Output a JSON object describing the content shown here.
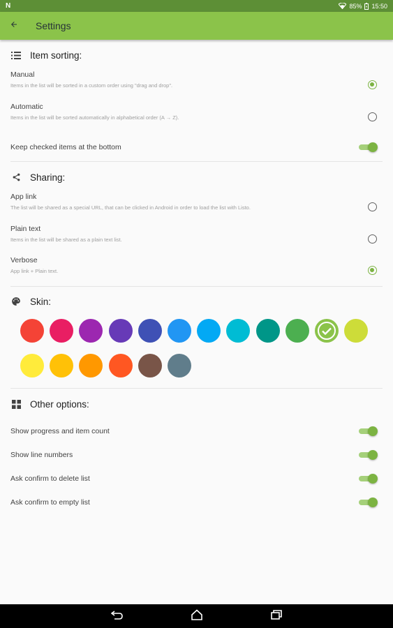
{
  "status_bar": {
    "left_icon": "N",
    "battery": "85%",
    "time": "15:50"
  },
  "app_bar": {
    "title": "Settings",
    "back_icon": "arrow-back-icon"
  },
  "sections": {
    "sorting": {
      "title": "Item sorting:",
      "icon": "list-icon",
      "manual": {
        "label": "Manual",
        "desc": "Items in the list will be sorted in a custom order using \"drag and drop\".",
        "selected": true
      },
      "automatic": {
        "label": "Automatic",
        "desc": "Items in the list will be sorted automatically in alphabetical order (A → Z).",
        "selected": false
      },
      "keep_checked": {
        "label": "Keep checked items at the bottom",
        "on": true
      }
    },
    "sharing": {
      "title": "Sharing:",
      "icon": "share-icon",
      "app_link": {
        "label": "App link",
        "desc": "The list will be shared as a special URL, that can be clicked in Android in order to load the list with Listo.",
        "selected": false
      },
      "plain_text": {
        "label": "Plain text",
        "desc": "Items in the list will be shared as a plain text list.",
        "selected": false
      },
      "verbose": {
        "label": "Verbose",
        "desc": "App link + Plain text.",
        "selected": true
      }
    },
    "skin": {
      "title": "Skin:",
      "icon": "palette-icon",
      "colors": [
        "#f44336",
        "#e91e63",
        "#9c27b0",
        "#673ab7",
        "#3f51b5",
        "#2196f3",
        "#03a9f4",
        "#00bcd4",
        "#009688",
        "#4caf50",
        "#8bc34a",
        "#cddc39",
        "#ffeb3b",
        "#ffc107",
        "#ff9800",
        "#ff5722",
        "#795548",
        "#607d8b"
      ],
      "selected_index": 10
    },
    "other": {
      "title": "Other options:",
      "icon": "widgets-icon",
      "show_progress": {
        "label": "Show progress and item count",
        "on": true
      },
      "show_line_numbers": {
        "label": "Show line numbers",
        "on": true
      },
      "confirm_delete": {
        "label": "Ask confirm to delete list",
        "on": true
      },
      "confirm_empty": {
        "label": "Ask confirm to empty list",
        "on": true
      }
    }
  },
  "nav_bar": {
    "back": "nav-back-icon",
    "home": "nav-home-icon",
    "recents": "nav-recents-icon"
  },
  "colors": {
    "app_bar": "#8bc34a",
    "status_bar": "#5d8f36",
    "accent": "#7cb342"
  }
}
